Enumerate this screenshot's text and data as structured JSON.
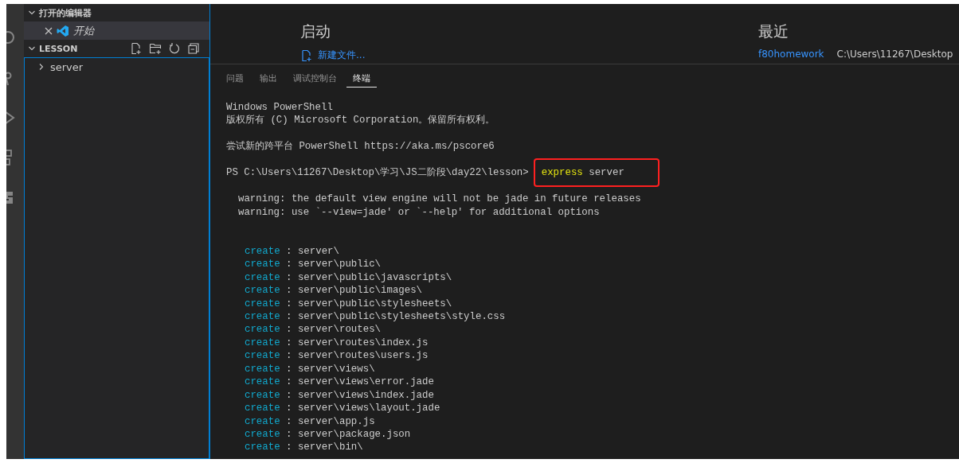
{
  "sidebar": {
    "open_editors": {
      "title": "打开的编辑器",
      "expanded": true,
      "items": [
        {
          "label": "开始",
          "selected": true
        }
      ]
    },
    "folder": {
      "title": "LESSON",
      "expanded": true,
      "items": [
        {
          "label": "server",
          "expanded": false
        }
      ]
    }
  },
  "welcome": {
    "start": {
      "title": "启动",
      "links": [
        "新建文件..."
      ]
    },
    "recent": {
      "title": "最近",
      "items": [
        {
          "name": "f80homework",
          "path": "C:\\Users\\11267\\Desktop"
        }
      ]
    }
  },
  "panel": {
    "tabs": [
      {
        "label": "问题",
        "selected": false
      },
      {
        "label": "输出",
        "selected": false
      },
      {
        "label": "调试控制台",
        "selected": false
      },
      {
        "label": "终端",
        "selected": true
      }
    ],
    "lines": [
      {
        "kind": "text",
        "text": "Windows PowerShell"
      },
      {
        "kind": "text",
        "text": "版权所有 (C) Microsoft Corporation。保留所有权利。"
      },
      {
        "kind": "blank"
      },
      {
        "kind": "text",
        "text": "尝试新的跨平台 PowerShell https://aka.ms/pscore6"
      },
      {
        "kind": "blank"
      },
      {
        "kind": "command",
        "prompt": "PS C:\\Users\\11267\\Desktop\\学习\\JS二阶段\\day22\\lesson>",
        "command": "express",
        "args": "server",
        "highlighted": true
      },
      {
        "kind": "blank"
      },
      {
        "kind": "warning",
        "text": "warning: the default view engine will not be jade in future releases"
      },
      {
        "kind": "warning",
        "text": "warning: use `--view=jade' or `--help' for additional options"
      },
      {
        "kind": "blank"
      },
      {
        "kind": "blank"
      },
      {
        "kind": "create",
        "action": "create",
        "separator": ":",
        "path": "server\\"
      },
      {
        "kind": "create",
        "action": "create",
        "separator": ":",
        "path": "server\\public\\"
      },
      {
        "kind": "create",
        "action": "create",
        "separator": ":",
        "path": "server\\public\\javascripts\\"
      },
      {
        "kind": "create",
        "action": "create",
        "separator": ":",
        "path": "server\\public\\images\\"
      },
      {
        "kind": "create",
        "action": "create",
        "separator": ":",
        "path": "server\\public\\stylesheets\\"
      },
      {
        "kind": "create",
        "action": "create",
        "separator": ":",
        "path": "server\\public\\stylesheets\\style.css"
      },
      {
        "kind": "create",
        "action": "create",
        "separator": ":",
        "path": "server\\routes\\"
      },
      {
        "kind": "create",
        "action": "create",
        "separator": ":",
        "path": "server\\routes\\index.js"
      },
      {
        "kind": "create",
        "action": "create",
        "separator": ":",
        "path": "server\\routes\\users.js"
      },
      {
        "kind": "create",
        "action": "create",
        "separator": ":",
        "path": "server\\views\\"
      },
      {
        "kind": "create",
        "action": "create",
        "separator": ":",
        "path": "server\\views\\error.jade"
      },
      {
        "kind": "create",
        "action": "create",
        "separator": ":",
        "path": "server\\views\\index.jade"
      },
      {
        "kind": "create",
        "action": "create",
        "separator": ":",
        "path": "server\\views\\layout.jade"
      },
      {
        "kind": "create",
        "action": "create",
        "separator": ":",
        "path": "server\\app.js"
      },
      {
        "kind": "create",
        "action": "create",
        "separator": ":",
        "path": "server\\package.json"
      },
      {
        "kind": "create",
        "action": "create",
        "separator": ":",
        "path": "server\\bin\\"
      }
    ]
  }
}
